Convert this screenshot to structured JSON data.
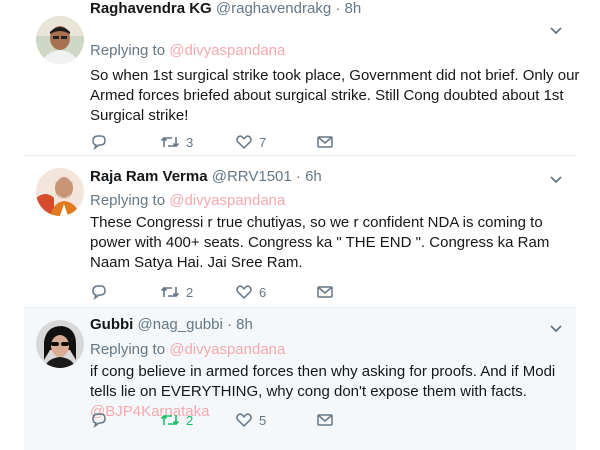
{
  "tweets": [
    {
      "name": "Raghavendra KG",
      "handle": "@raghavendrakg",
      "sep": "·",
      "time": "8h",
      "replying_prefix": "Replying to",
      "replying_to": "@divyaspandana",
      "text": "So when 1st surgical strike took place, Government did not brief.  Only our Armed forces  briefed about surgical strike.  Still Cong  doubted about  1st Surgical strike!",
      "mention_tail": "",
      "replies": "",
      "retweets": "3",
      "likes": "7"
    },
    {
      "name": "Raja Ram Verma",
      "handle": "@RRV1501",
      "sep": "·",
      "time": "6h",
      "replying_prefix": "Replying to",
      "replying_to": "@divyaspandana",
      "text": "These Congressi r true chutiyas, so we r confident NDA is coming to power with 400+ seats. Congress ka \" THE END \". Congress ka Ram Naam Satya Hai. Jai Sree Ram.",
      "mention_tail": "",
      "replies": "",
      "retweets": "2",
      "likes": "6"
    },
    {
      "name": "Gubbi",
      "handle": "@nag_gubbi",
      "sep": "·",
      "time": "8h",
      "replying_prefix": "Replying to",
      "replying_to": "@divyaspandana",
      "text": "if cong believe in armed forces then why asking for proofs. And if Modi tells lie on EVERYTHING, why cong don't expose them with facts. ",
      "mention_tail": "@BJP4Karnataka",
      "replies": "",
      "retweets": "2",
      "likes": "5"
    }
  ],
  "colors": {
    "text": "#14171a",
    "muted": "#657786",
    "mention": "#f4a9b0",
    "retweet_active": "#17bf63",
    "border": "#e6ecf0",
    "highlight_bg": "#f5f8fa"
  },
  "icons": {
    "reply": "reply-icon",
    "retweet": "retweet-icon",
    "like": "heart-icon",
    "dm": "envelope-icon",
    "menu": "chevron-down-icon"
  }
}
